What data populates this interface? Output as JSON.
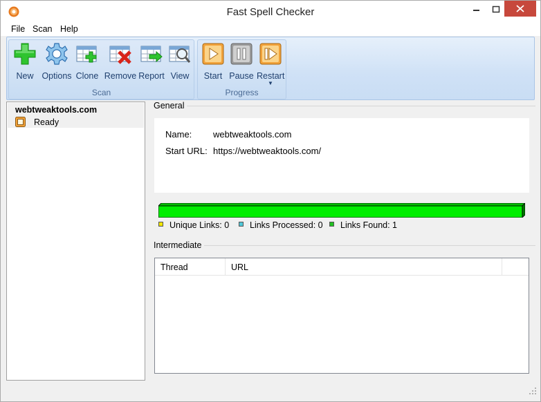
{
  "window": {
    "title": "Fast Spell Checker",
    "accent_close": "#c7483c"
  },
  "menu": {
    "file": "File",
    "scan": "Scan",
    "help": "Help"
  },
  "ribbon": {
    "scan_group": {
      "label": "Scan",
      "buttons": [
        {
          "label": "New",
          "icon": "plus-icon"
        },
        {
          "label": "Options",
          "icon": "gear-icon"
        },
        {
          "label": "Clone",
          "icon": "clone-table-icon"
        },
        {
          "label": "Remove",
          "icon": "remove-table-icon"
        },
        {
          "label": "Report",
          "icon": "report-table-icon"
        },
        {
          "label": "View",
          "icon": "view-magnifier-icon"
        }
      ]
    },
    "progress_group": {
      "label": "Progress",
      "buttons": [
        {
          "label": "Start",
          "icon": "play-icon"
        },
        {
          "label": "Pause",
          "icon": "pause-icon"
        },
        {
          "label": "Restart",
          "icon": "restart-icon"
        }
      ]
    }
  },
  "sidebar": {
    "items": [
      {
        "title": "webtweaktools.com",
        "status": "Ready"
      }
    ]
  },
  "general": {
    "caption": "General",
    "name_label": "Name:",
    "name_value": "webtweaktools.com",
    "url_label": "Start URL:",
    "url_value": "https://webtweaktools.com/",
    "progress_fraction": 1.0,
    "progress_color": "#00ee00",
    "legend": [
      {
        "text": "Unique Links: 0",
        "color": "#f2e600"
      },
      {
        "text": "Links Processed: 0",
        "color": "#4fc8d8"
      },
      {
        "text": "Links Found: 1",
        "color": "#22c222"
      }
    ]
  },
  "intermediate": {
    "caption": "Intermediate",
    "columns": [
      "Thread",
      "URL",
      ""
    ],
    "rows": []
  }
}
